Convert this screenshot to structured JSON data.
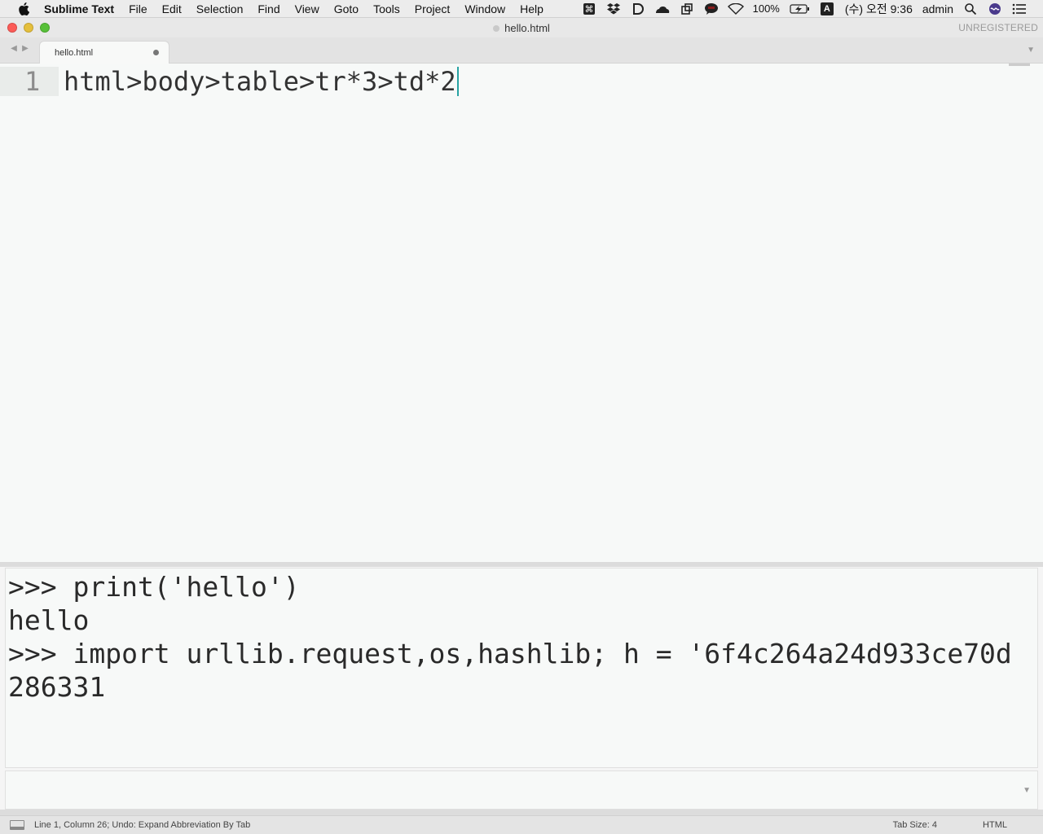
{
  "menubar": {
    "app_name": "Sublime Text",
    "items": [
      "File",
      "Edit",
      "Selection",
      "Find",
      "View",
      "Goto",
      "Tools",
      "Project",
      "Window",
      "Help"
    ],
    "battery": "100%",
    "input_indicator": "A",
    "clock": "(수) 오전 9:36",
    "user": "admin",
    "status_icons": [
      "command-icon",
      "dropbox-icon",
      "d-app-icon",
      "cloud-icon",
      "screens-icon",
      "chat-bubble-icon",
      "wifi-icon",
      "battery-charging-icon",
      "search-icon",
      "siri-icon",
      "list-icon"
    ]
  },
  "window": {
    "title": "hello.html",
    "registration": "UNREGISTERED"
  },
  "tabs": [
    {
      "label": "hello.html",
      "dirty": true
    }
  ],
  "editor": {
    "line_number": "1",
    "line_text": "html>body>table>tr*3>td*2"
  },
  "console": {
    "output": ">>> print('hello')\nhello\n>>> import urllib.request,os,hashlib; h = '6f4c264a24d933ce70d\n286331"
  },
  "statusbar": {
    "message": "Line 1, Column 26; Undo: Expand Abbreviation By Tab",
    "tab_size": "Tab Size: 4",
    "syntax": "HTML"
  },
  "colors": {
    "caret": "#27a3a3",
    "close": "#fc5b57",
    "minimize": "#e5bf3c",
    "zoom": "#57c038"
  }
}
